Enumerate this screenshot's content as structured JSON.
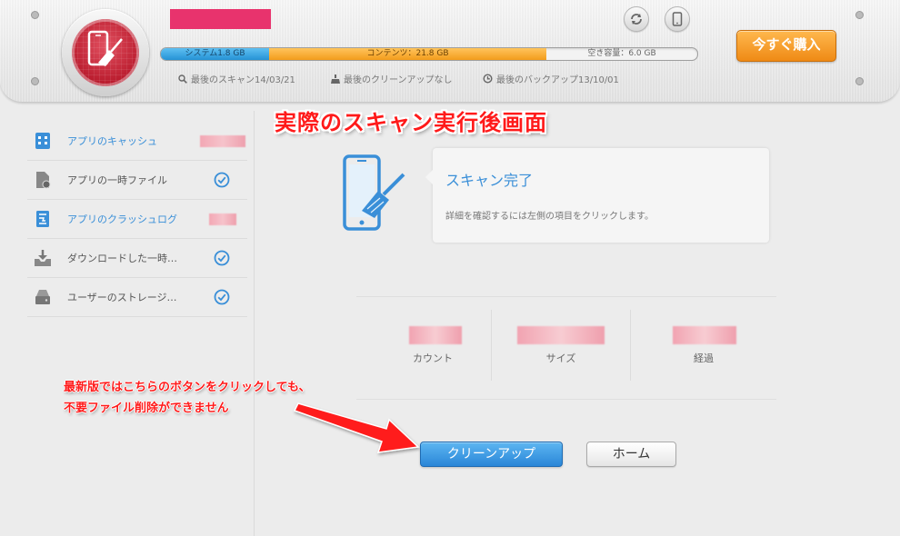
{
  "header": {
    "storage": {
      "system_label": "システム1.8 GB",
      "content_label": "コンテンツ：21.8 GB",
      "free_label": "空き容量：6.0 GB"
    },
    "last_scan": "最後のスキャン14/03/21",
    "last_cleanup": "最後のクリーンアップなし",
    "last_backup": "最後のバックアップ13/10/01",
    "buy_label": "今すぐ購入"
  },
  "annotation_top": "実際のスキャン実行後画面",
  "sidebar": {
    "items": [
      {
        "label": "アプリのキャッシュ",
        "status": "redacted",
        "icon": "app-cache-icon"
      },
      {
        "label": "アプリの一時ファイル",
        "status": "clean",
        "icon": "temp-file-icon"
      },
      {
        "label": "アプリのクラッシュログ",
        "status": "redacted",
        "icon": "crash-log-icon"
      },
      {
        "label": "ダウンロードした一時…",
        "status": "clean",
        "icon": "download-icon"
      },
      {
        "label": "ユーザーのストレージ…",
        "status": "clean",
        "icon": "storage-icon"
      }
    ]
  },
  "main": {
    "scan_title": "スキャン完了",
    "scan_sub": "詳細を確認するには左側の項目をクリックします。",
    "stats": {
      "count_label": "カウント",
      "size_label": "サイズ",
      "elapsed_label": "経過"
    },
    "cleanup_label": "クリーンアップ",
    "home_label": "ホーム"
  },
  "annotation_mid": {
    "line1": "最新版ではこちらのボタンをクリックしても、",
    "line2": "不要ファイル削除ができません"
  },
  "colors": {
    "accent_blue": "#3a8fd8",
    "brand_red": "#c2192d",
    "buy_orange": "#f39c1c",
    "annotation_red": "#ff1a1a"
  }
}
